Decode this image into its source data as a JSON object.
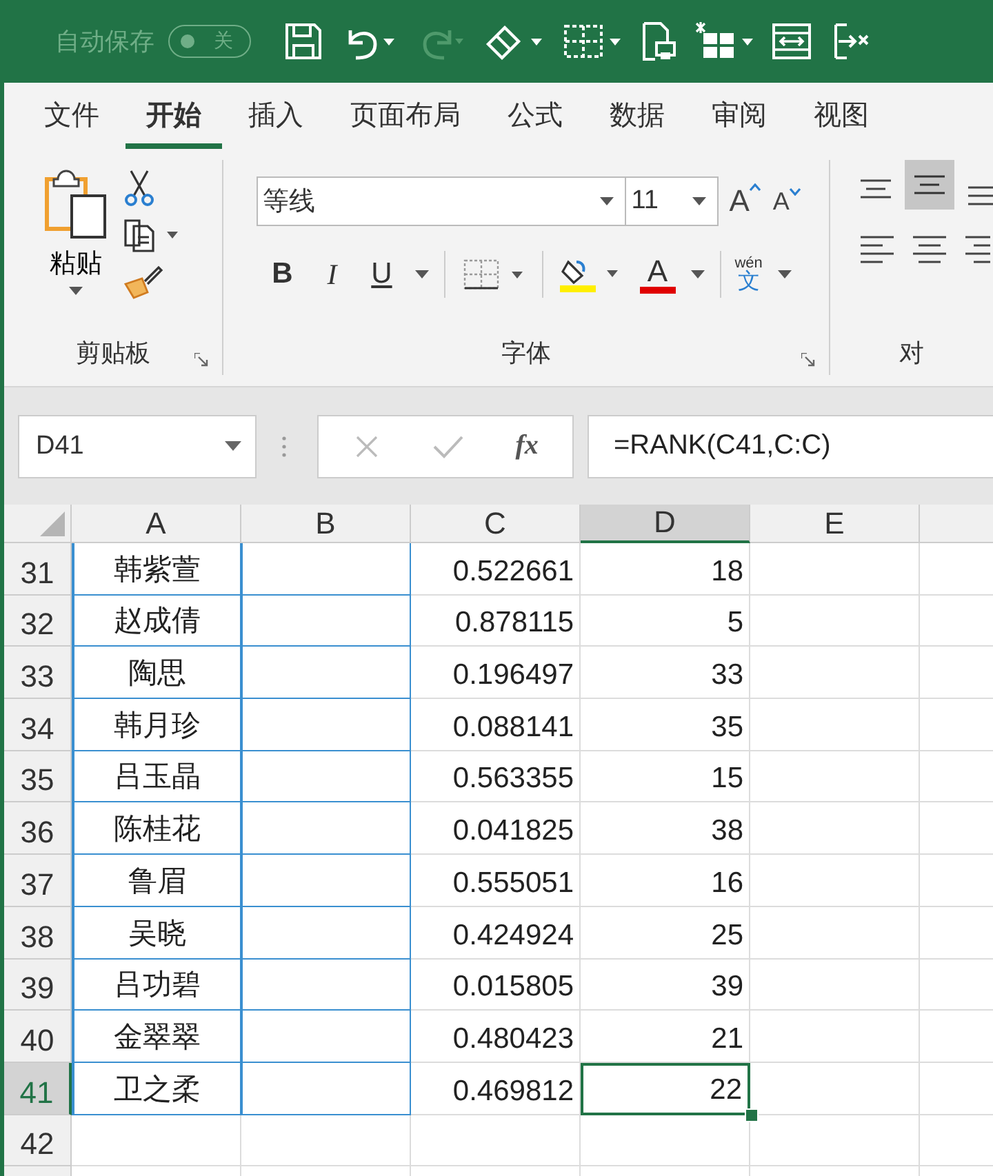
{
  "title_bar": {
    "autosave_label": "自动保存",
    "autosave_toggle": {
      "on": false,
      "label": "关"
    }
  },
  "tabs": [
    {
      "label": "文件",
      "selected": false
    },
    {
      "label": "开始",
      "selected": true
    },
    {
      "label": "插入",
      "selected": false
    },
    {
      "label": "页面布局",
      "selected": false
    },
    {
      "label": "公式",
      "selected": false
    },
    {
      "label": "数据",
      "selected": false
    },
    {
      "label": "审阅",
      "selected": false
    },
    {
      "label": "视图",
      "selected": false
    }
  ],
  "ribbon": {
    "clipboard": {
      "paste_label": "粘贴",
      "group_label": "剪贴板"
    },
    "font": {
      "font_name": "等线",
      "font_size": "11",
      "bold": "B",
      "italic": "I",
      "underline": "U",
      "font_color_letter": "A",
      "grow_letter": "A",
      "shrink_letter": "A",
      "phonetic_top": "wén",
      "phonetic_bottom": "文",
      "group_label": "字体"
    },
    "alignment": {
      "group_label": "对"
    }
  },
  "formula_bar": {
    "name_box": "D41",
    "fx": "fx",
    "formula": "=RANK(C41,C:C)"
  },
  "columns": [
    {
      "label": "A",
      "selected": false
    },
    {
      "label": "B",
      "selected": false
    },
    {
      "label": "C",
      "selected": false
    },
    {
      "label": "D",
      "selected": true
    },
    {
      "label": "E",
      "selected": false
    }
  ],
  "rows": [
    {
      "number": "31",
      "name": "韩紫萱",
      "value": "0.522661",
      "rank": "18",
      "selected": false
    },
    {
      "number": "32",
      "name": "赵成倩",
      "value": "0.878115",
      "rank": "5",
      "selected": false
    },
    {
      "number": "33",
      "name": "陶思",
      "value": "0.196497",
      "rank": "33",
      "selected": false
    },
    {
      "number": "34",
      "name": "韩月珍",
      "value": "0.088141",
      "rank": "35",
      "selected": false
    },
    {
      "number": "35",
      "name": "吕玉晶",
      "value": "0.563355",
      "rank": "15",
      "selected": false
    },
    {
      "number": "36",
      "name": "陈桂花",
      "value": "0.041825",
      "rank": "38",
      "selected": false
    },
    {
      "number": "37",
      "name": "鲁眉",
      "value": "0.555051",
      "rank": "16",
      "selected": false
    },
    {
      "number": "38",
      "name": "吴晓",
      "value": "0.424924",
      "rank": "25",
      "selected": false
    },
    {
      "number": "39",
      "name": "吕功碧",
      "value": "0.015805",
      "rank": "39",
      "selected": false
    },
    {
      "number": "40",
      "name": "金翠翠",
      "value": "0.480423",
      "rank": "21",
      "selected": false
    },
    {
      "number": "41",
      "name": "卫之柔",
      "value": "0.469812",
      "rank": "22",
      "selected": true
    },
    {
      "number": "42",
      "name": "",
      "value": "",
      "rank": "",
      "selected": false
    }
  ]
}
